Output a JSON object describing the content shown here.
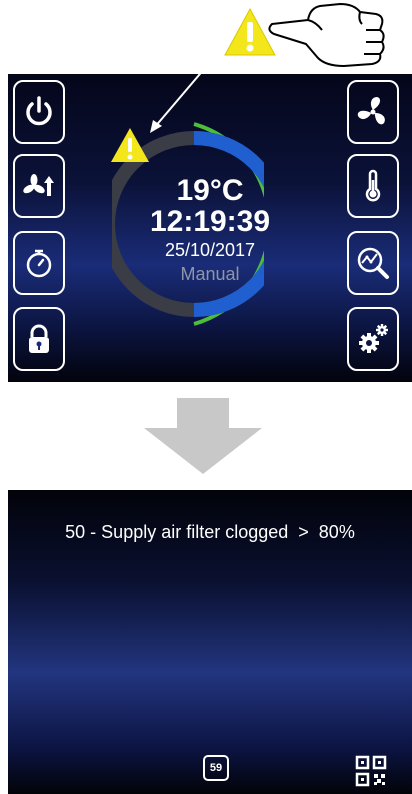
{
  "main_screen": {
    "temperature": "19°C",
    "time": "12:19:39",
    "date": "25/10/2017",
    "mode": "Manual",
    "ring_colors": {
      "track": "#3a3d45",
      "progress_blue": "#1f5fd0",
      "outer_green": "#4cbe3c"
    }
  },
  "left_buttons": [
    "power-icon",
    "fan-boost-icon",
    "timer-icon",
    "lock-icon"
  ],
  "right_buttons": [
    "fan-icon",
    "thermometer-icon",
    "chart-search-icon",
    "settings-gears-icon"
  ],
  "warning_color": "#f3e61a",
  "arrow_color": "#c8c8c8",
  "alarm_screen": {
    "message": "50 - Supply air filter clogged  >  80%",
    "badge": "59",
    "qr_icon": "qr-code-icon"
  }
}
